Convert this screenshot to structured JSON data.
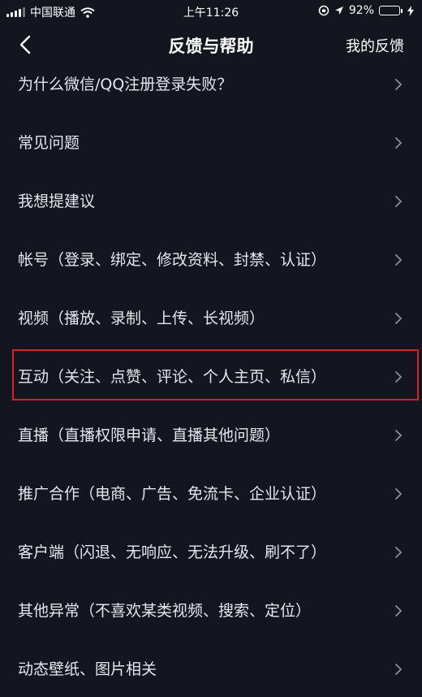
{
  "status_bar": {
    "carrier": "中国联通",
    "time": "上午11:26",
    "battery_percent": "92%",
    "battery_level": 0.92,
    "battery_color": "#4cd964"
  },
  "nav": {
    "title": "反馈与帮助",
    "right_label": "我的反馈",
    "back_icon": "chevron-left-icon"
  },
  "items": [
    {
      "label": "为什么微信/QQ注册登录失败？"
    },
    {
      "label": "常见问题"
    },
    {
      "label": "我想提建议"
    },
    {
      "label": "帐号（登录、绑定、修改资料、封禁、认证）"
    },
    {
      "label": "视频（播放、录制、上传、长视频）"
    },
    {
      "label": "互动（关注、点赞、评论、个人主页、私信）"
    },
    {
      "label": "直播（直播权限申请、直播其他问题）"
    },
    {
      "label": "推广合作（电商、广告、免流卡、企业认证）"
    },
    {
      "label": "客户端（闪退、无响应、无法升级、刷不了）"
    },
    {
      "label": "其他异常（不喜欢某类视频、搜索、定位）"
    },
    {
      "label": "动态壁纸、图片相关"
    }
  ],
  "highlight_color": "#d8222a"
}
